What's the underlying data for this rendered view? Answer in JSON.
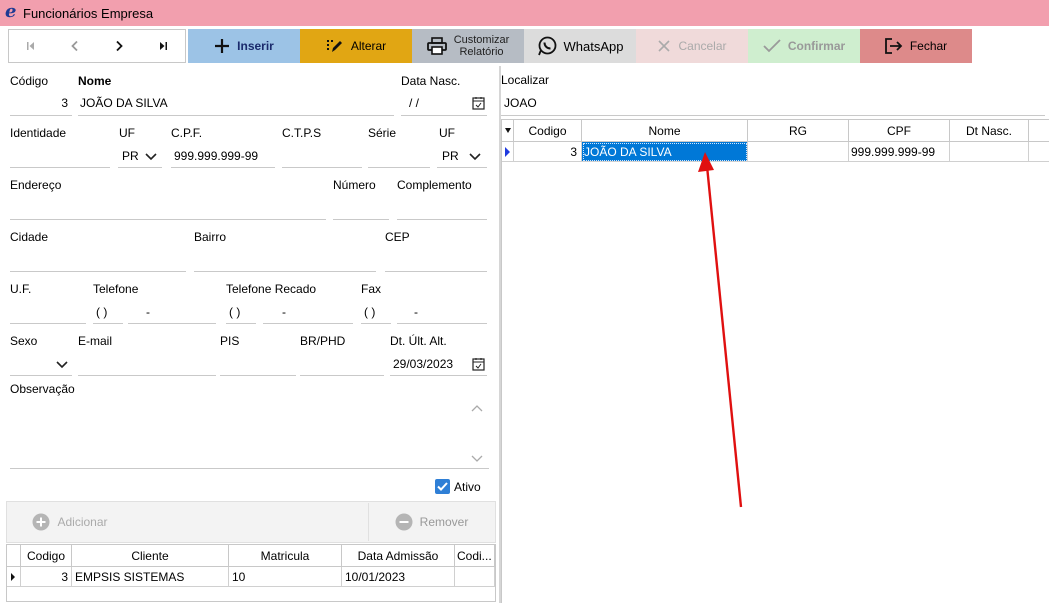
{
  "window": {
    "title": "Funcionários Empresa",
    "logo": "e"
  },
  "toolbar": {
    "buttons": [
      {
        "label": "Inserir",
        "icon": "plus-icon",
        "color": "#9cc3e6"
      },
      {
        "label": "Alterar",
        "icon": "edit-icon",
        "color": "#e1a613"
      },
      {
        "label_line1": "Customizar",
        "label_line2": "Relatório",
        "icon": "printer-icon",
        "color": "#b6bcc4"
      },
      {
        "label": "WhatsApp",
        "icon": "whatsapp-icon",
        "color": "#dcdcdc"
      },
      {
        "label": "Cancelar",
        "icon": "x-icon",
        "color": "#f0dada"
      },
      {
        "label": "Confirmar",
        "icon": "check-icon",
        "color": "#cfeecf"
      },
      {
        "label": "Fechar",
        "icon": "exit-icon",
        "color": "#dd8a8a"
      }
    ]
  },
  "form": {
    "codigo_label": "Código",
    "codigo": "3",
    "nome_label": "Nome",
    "nome": "JOÃO DA SILVA",
    "data_nasc_label": "Data Nasc.",
    "data_nasc": " /  /",
    "identidade_label": "Identidade",
    "uf_label": "UF",
    "uf": "PR",
    "cpf_label": "C.P.F.",
    "cpf": "999.999.999-99",
    "ctps_label": "C.T.P.S",
    "serie_label": "Série",
    "uf2_label": "UF",
    "uf2": "PR",
    "endereco_label": "Endereço",
    "numero_label": "Número",
    "complemento_label": "Complemento",
    "cidade_label": "Cidade",
    "bairro_label": "Bairro",
    "cep_label": "CEP",
    "uf3_label": "U.F.",
    "telefone_label": "Telefone",
    "telefone_ddd": "(  )",
    "telefone_dash": "-",
    "telefone_recado_label": "Telefone Recado",
    "recado_ddd": "(  )",
    "recado_dash": "-",
    "fax_label": "Fax",
    "fax_ddd": "(  )",
    "fax_dash": "-",
    "sexo_label": "Sexo",
    "email_label": "E-mail",
    "pis_label": "PIS",
    "brphd_label": "BR/PHD",
    "dt_ult_alt_label": "Dt. Últ. Alt.",
    "dt_ult_alt": "29/03/2023",
    "observacao_label": "Observação",
    "ativo_label": "Ativo",
    "ativo": true
  },
  "subgrid": {
    "adicionar_label": "Adicionar",
    "remover_label": "Remover",
    "columns": [
      "Codigo",
      "Cliente",
      "Matricula",
      "Data Admissão",
      "Codi..."
    ],
    "rows": [
      {
        "codigo": "3",
        "cliente": "EMPSIS SISTEMAS",
        "matricula": "10",
        "data_admissao": "10/01/2023",
        "codi": ""
      }
    ]
  },
  "search": {
    "localizar_label": "Localizar",
    "query": "JOAO",
    "columns": [
      "Codigo",
      "Nome",
      "RG",
      "CPF",
      "Dt Nasc."
    ],
    "rows": [
      {
        "codigo": "3",
        "nome": "JOÃO DA SILVA",
        "rg": "",
        "cpf": "999.999.999-99",
        "dt_nasc": ""
      }
    ]
  },
  "colors": {
    "titlebar": "#f29fae",
    "selection": "#0078d7",
    "annotation_arrow": "#e01010"
  }
}
